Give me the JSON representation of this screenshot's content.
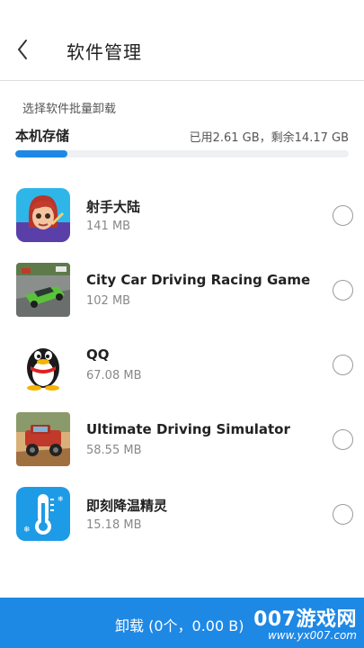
{
  "header": {
    "title": "软件管理",
    "back_icon": "chevron-left-icon"
  },
  "storage": {
    "hint": "选择软件批量卸载",
    "label": "本机存储",
    "info": "已用2.61 GB，剩余14.17 GB",
    "used_fraction": 0.156,
    "bar_color": "#1e88e5"
  },
  "apps": [
    {
      "name": "射手大陆",
      "size": "141 MB",
      "icon": "archer-game-icon",
      "selected": false
    },
    {
      "name": "City Car Driving Racing Game",
      "size": "102 MB",
      "icon": "car-racing-icon",
      "selected": false
    },
    {
      "name": "QQ",
      "size": "67.08 MB",
      "icon": "qq-penguin-icon",
      "selected": false
    },
    {
      "name": "Ultimate Driving Simulator",
      "size": "58.55 MB",
      "icon": "offroad-truck-icon",
      "selected": false
    },
    {
      "name": "即刻降温精灵",
      "size": "15.18 MB",
      "icon": "thermometer-icon",
      "selected": false
    }
  ],
  "footer": {
    "uninstall_label": "卸载 (0个，0.00 B)",
    "accent_color": "#1e88e5"
  },
  "watermark": {
    "brand": "007游戏网",
    "url": "www.yx007.com"
  }
}
